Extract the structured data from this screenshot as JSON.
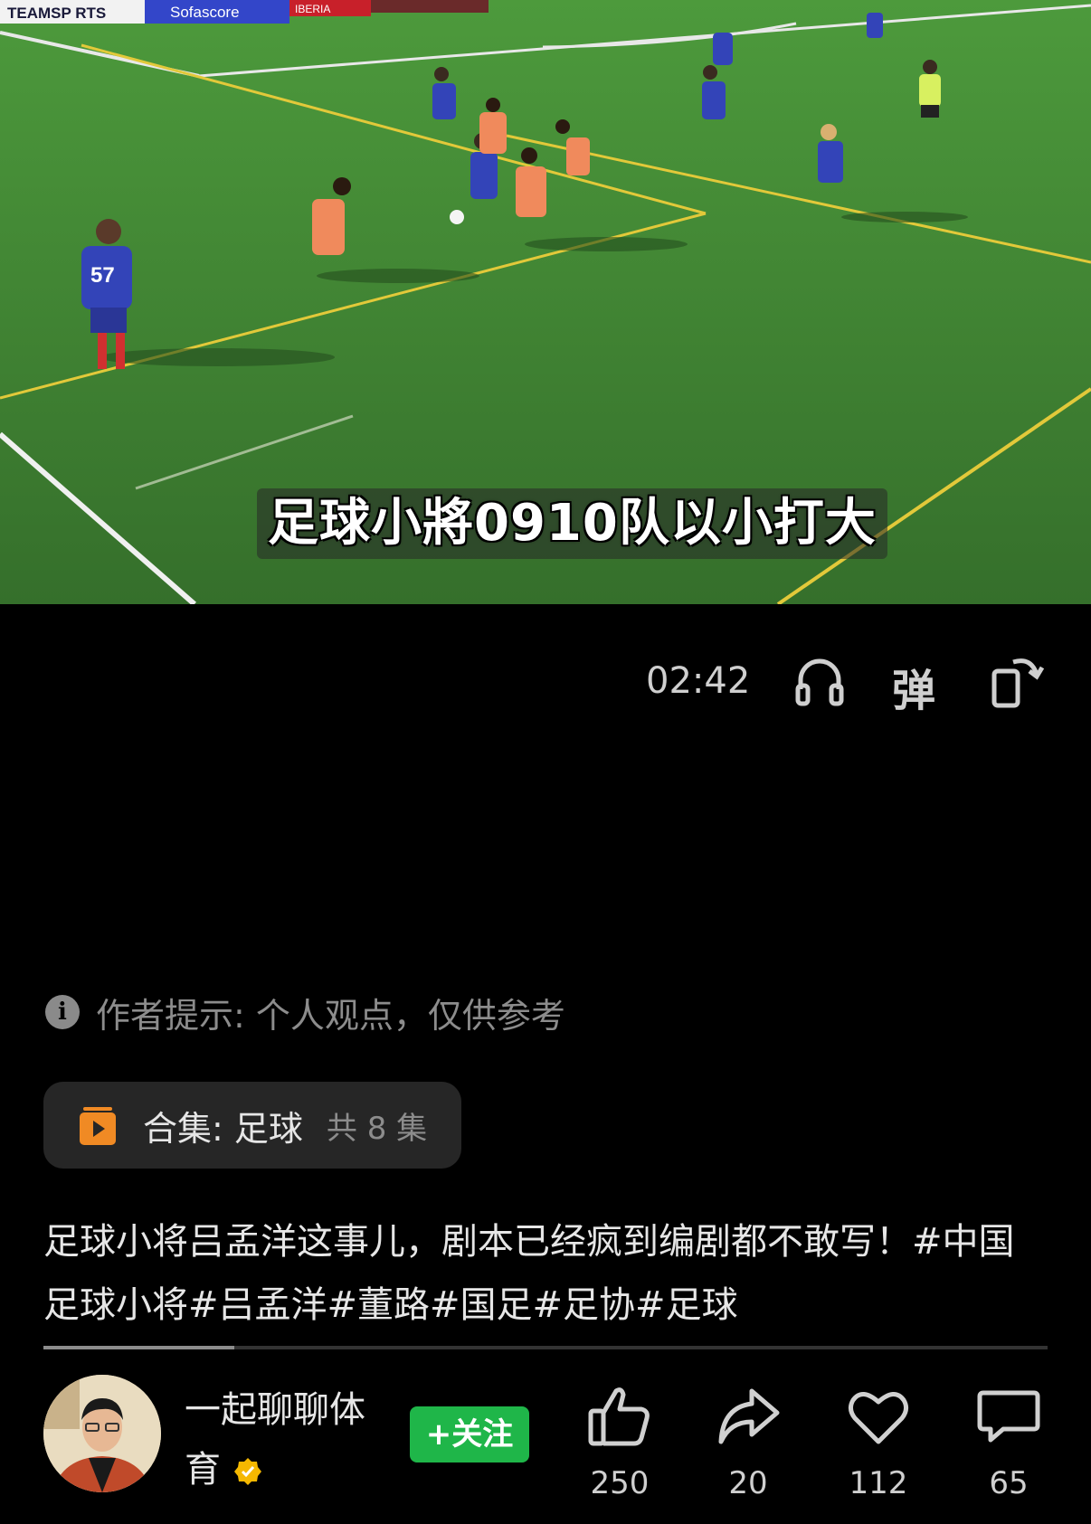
{
  "video": {
    "subtitle": "足球小將0910队以小打大",
    "ad_boards": [
      "TEAMSP RTS",
      "Sofascore",
      "IBERIA"
    ],
    "jersey_number": "57",
    "duration": "02:42"
  },
  "controls": {
    "icons": [
      "headphones-icon",
      "danmaku-icon",
      "rotate-screen-icon"
    ],
    "danmaku_label": "弹"
  },
  "notice": {
    "icon": "info-icon",
    "text": "作者提示: 个人观点，仅供参考"
  },
  "collection": {
    "icon": "collection-icon",
    "label": "合集: 足球",
    "count": "共 8 集"
  },
  "description": "足球小将吕孟洋这事儿，剧本已经疯到编剧都不敢写！#中国足球小将#吕孟洋#董路#国足#足协#足球",
  "progress": {
    "fraction": 0.19
  },
  "author": {
    "name": "一起聊聊体育",
    "verified": true,
    "follow_label": "+关注"
  },
  "actions": [
    {
      "name": "like",
      "icon": "thumbs-up-icon",
      "count": "250"
    },
    {
      "name": "share",
      "icon": "share-icon",
      "count": "20"
    },
    {
      "name": "favorite",
      "icon": "heart-icon",
      "count": "112"
    },
    {
      "name": "comment",
      "icon": "comment-icon",
      "count": "65"
    }
  ],
  "colors": {
    "background": "#000000",
    "follow_green": "#1fb649",
    "verified_badge": "#f5b800",
    "collection_orange": "#f08a24"
  }
}
